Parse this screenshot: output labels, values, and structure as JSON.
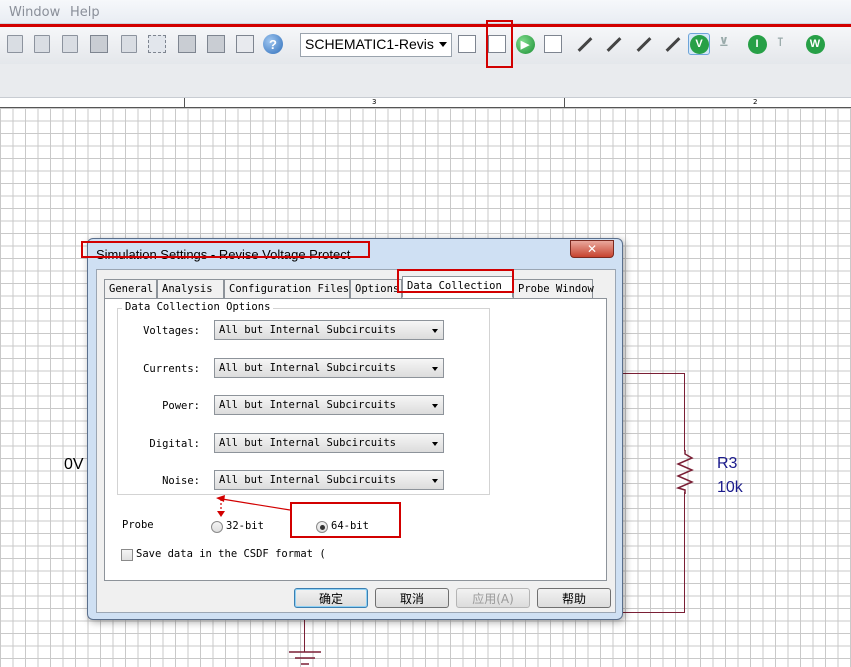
{
  "menubar": {
    "items": [
      "Window",
      "Help"
    ]
  },
  "toolbar": {
    "profile_selector": "SCHEMATIC1-Revis",
    "icons": [
      "new-page-icon",
      "open-page-icon",
      "document-icon",
      "library-icon",
      "report-icon",
      "select-area-icon",
      "part-icon",
      "zoom-area-icon",
      "hierarchy-icon",
      "help-icon",
      "new-simulation-profile-icon",
      "edit-simulation-settings-icon",
      "run-icon",
      "view-results-icon",
      "voltage-marker-icon",
      "current-marker-icon",
      "power-marker-icon",
      "diff-marker-icon",
      "bias-voltage-icon",
      "bias-voltage-toggle-icon",
      "bias-current-icon",
      "bias-current-toggle-icon",
      "bias-power-icon"
    ],
    "marker_letters": [
      "V",
      "I",
      "W"
    ]
  },
  "ruler": {
    "ticks": [
      "3",
      "2"
    ]
  },
  "schematic": {
    "left_label": "0V",
    "resistor_name": "R3",
    "resistor_value": "10k"
  },
  "dialog": {
    "title": "Simulation Settings - Revise Voltage Protect",
    "close_label": "✕",
    "tabs": [
      "General",
      "Analysis",
      "Configuration Files",
      "Options",
      "Data Collection",
      "Probe Window"
    ],
    "active_tab": "Data Collection",
    "group_title": "Data Collection Options",
    "rows": [
      {
        "label": "Voltages:",
        "value": "All but Internal Subcircuits"
      },
      {
        "label": "Currents:",
        "value": "All but Internal Subcircuits"
      },
      {
        "label": "Power:",
        "value": "All but Internal Subcircuits"
      },
      {
        "label": "Digital:",
        "value": "All but Internal Subcircuits"
      },
      {
        "label": "Noise:",
        "value": "All but Internal Subcircuits"
      }
    ],
    "probe_label": "Probe",
    "probe_options": [
      {
        "label": "32-bit",
        "selected": false
      },
      {
        "label": "64-bit",
        "selected": true
      }
    ],
    "csdf_checkbox": {
      "label": "Save data in the CSDF format (",
      "checked": false
    },
    "buttons": {
      "ok": "确定",
      "cancel": "取消",
      "apply": "应用(A)",
      "help": "帮助"
    }
  },
  "colors": {
    "highlight": "#d20000",
    "wire": "#7a1f35",
    "schematic_text": "#1a1a8c"
  }
}
